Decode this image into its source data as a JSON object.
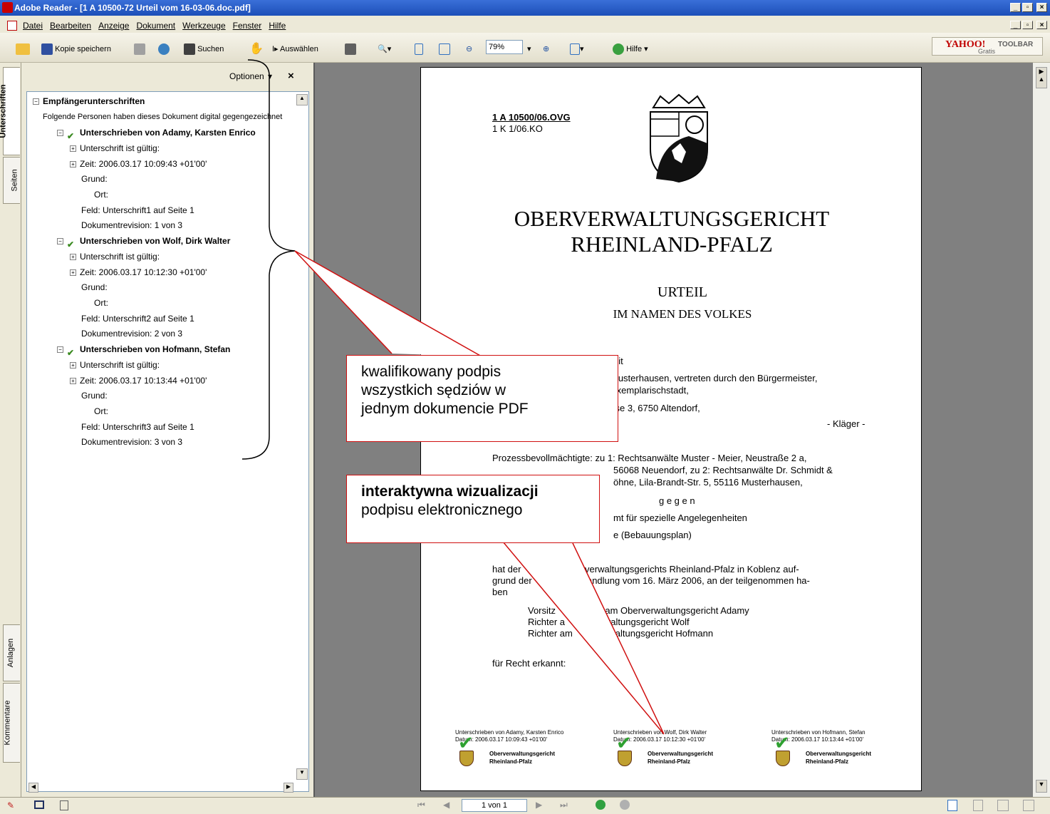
{
  "window": {
    "title": "Adobe Reader - [1 A 10500-72 Urteil vom 16-03-06.doc.pdf]",
    "min": "_",
    "max": "▫",
    "close": "×"
  },
  "menu": [
    "Datei",
    "Bearbeiten",
    "Anzeige",
    "Dokument",
    "Werkzeuge",
    "Fenster",
    "Hilfe"
  ],
  "toolbar": {
    "save_copy": "Kopie speichern",
    "search": "Suchen",
    "select": "Auswählen",
    "zoom": "79%",
    "help": "Hilfe",
    "yahoo": "YAHOO!",
    "yahoo_toolbar": "TOOLBAR",
    "yahoo_gratis": "Gratis"
  },
  "left_tabs": {
    "signatures": "Unterschriften",
    "pages": "Seiten",
    "attachments": "Anlagen",
    "comments": "Kommentare"
  },
  "panel": {
    "options": "Optionen",
    "close": "×",
    "root": "Empfängerunterschriften",
    "intro": "Folgende Personen haben dieses Dokument digital gegengezeichnet",
    "signers": [
      {
        "name": "Unterschrieben von Adamy, Karsten Enrico",
        "valid": "Unterschrift ist gültig:",
        "time": "Zeit: 2006.03.17 10:09:43 +01'00'",
        "reason": "Grund:",
        "place": "Ort:",
        "field": "Feld: Unterschrift1 auf Seite 1",
        "revision": "Dokumentrevision: 1 von 3"
      },
      {
        "name": "Unterschrieben von Wolf, Dirk Walter",
        "valid": "Unterschrift ist gültig:",
        "time": "Zeit: 2006.03.17 10:12:30 +01'00'",
        "reason": "Grund:",
        "place": "Ort:",
        "field": "Feld: Unterschrift2 auf Seite 1",
        "revision": "Dokumentrevision: 2 von 3"
      },
      {
        "name": "Unterschrieben von Hofmann, Stefan",
        "valid": "Unterschrift ist gültig:",
        "time": "Zeit: 2006.03.17 10:13:44 +01'00'",
        "reason": "Grund:",
        "place": "Ort:",
        "field": "Feld: Unterschrift3 auf Seite 1",
        "revision": "Dokumentrevision: 3 von 3"
      }
    ]
  },
  "document": {
    "ref1": "1 A 10500/06.OVG",
    "ref2": "1 K 1/06.KO",
    "court1": "OBERVERWALTUNGSGERICHT",
    "court2": "RHEINLAND-PFALZ",
    "urteil": "URTEIL",
    "volk": "IM NAMEN DES VOLKES",
    "l1": "eit",
    "l2": "Musterhausen, vertreten durch den Bürgermeister,",
    "l3": "Exemplarischstadt,",
    "l4": "sse 3, 6750 Altendorf,",
    "klaeger": "- Kläger -",
    "pb1": "Prozessbevollmächtigte:   zu 1: Rechtsanwälte Muster - Meier, Neustraße 2 a,",
    "pb2": "56068 Neuendorf,   zu 2: Rechtsanwälte Dr. Schmidt &",
    "pb3": "öhne, Lila-Brandt-Str. 5, 55116 Musterhausen,",
    "gegen": "g e g e n",
    "amt": "mt für spezielle Angelegenheiten",
    "bplan": "e  (Bebauungsplan)",
    "hat1": "hat der              s Oberverwaltungsgerichts Rheinland-Pfalz in Koblenz auf-",
    "hat2": "grund der              Verhandlung vom 16. März 2006, an der teilgenommen ha-",
    "hat3": "ben",
    "j1": "Vorsitz              ter am Oberverwaltungsgericht Adamy",
    "j2": "Richter a              rwaltungsgericht Wolf",
    "j3": "Richter am              waltungsgericht Hofmann",
    "erkannt": "für Recht erkannt:",
    "sigs": [
      {
        "by": "Unterschrieben von Adamy, Karsten Enrico",
        "date": "Datum: 2006.03.17 10:09:43 +01'00'",
        "org1": "Oberverwaltungsgericht",
        "org2": "Rheinland-Pfalz"
      },
      {
        "by": "Unterschrieben von Wolf, Dirk Walter",
        "date": "Datum: 2006.03.17 10:12:30 +01'00'",
        "org1": "Oberverwaltungsgericht",
        "org2": "Rheinland-Pfalz"
      },
      {
        "by": "Unterschrieben von Hofmann, Stefan",
        "date": "Datum: 2006.03.17 10:13:44 +01'00'",
        "org1": "Oberverwaltungsgericht",
        "org2": "Rheinland-Pfalz"
      }
    ]
  },
  "callouts": {
    "c1_l1": "kwalifikowany podpis",
    "c1_l2": "wszystkich sędziów w",
    "c1_l3": "jednym dokumencie PDF",
    "c2_bold": "interaktywna wizualizacji",
    "c2_l2": "podpisu elektronicznego"
  },
  "status": {
    "page": "1 von 1"
  }
}
